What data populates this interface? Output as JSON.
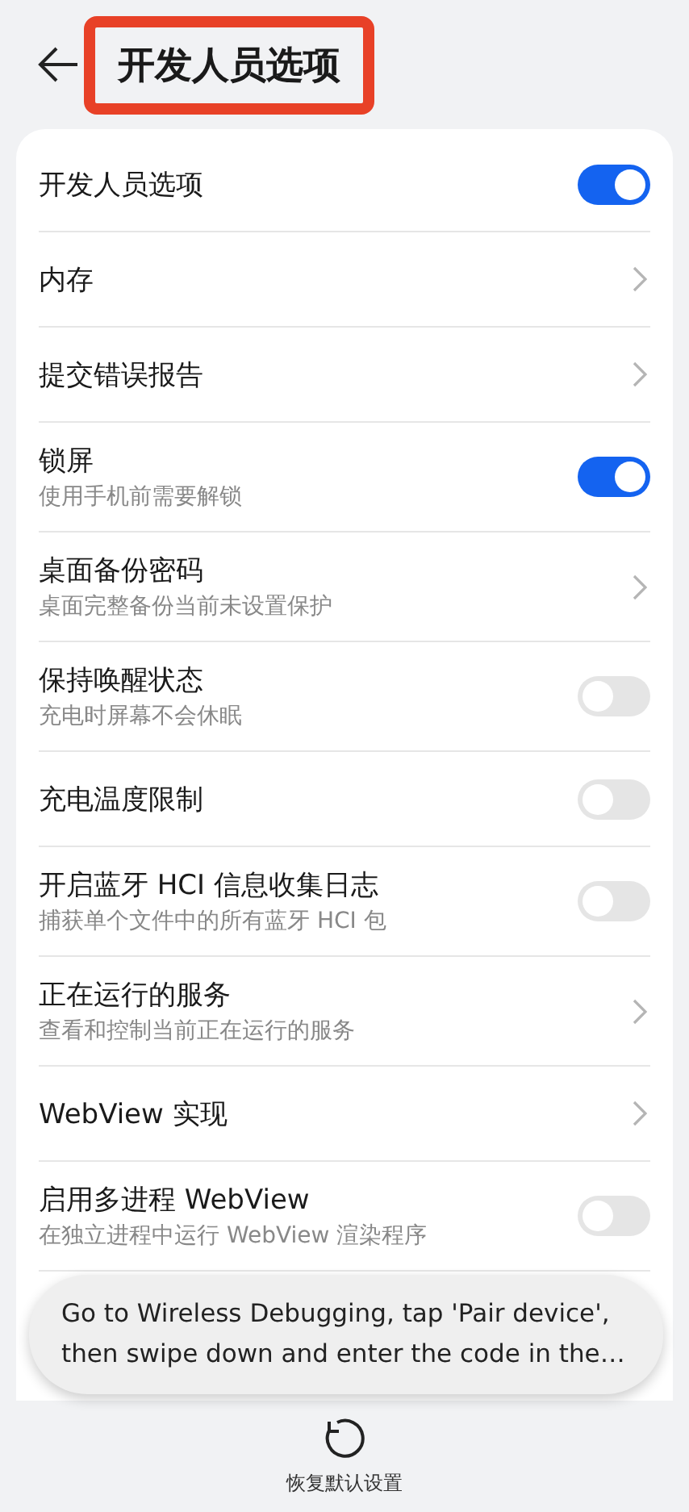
{
  "header": {
    "title": "开发人员选项",
    "highlighted": true
  },
  "settings": [
    {
      "kind": "toggle",
      "title": "开发人员选项",
      "on": true
    },
    {
      "kind": "link",
      "title": "内存"
    },
    {
      "kind": "link",
      "title": "提交错误报告"
    },
    {
      "kind": "toggle",
      "title": "锁屏",
      "subtitle": "使用手机前需要解锁",
      "on": true
    },
    {
      "kind": "link",
      "title": "桌面备份密码",
      "subtitle": "桌面完整备份当前未设置保护"
    },
    {
      "kind": "toggle",
      "title": "保持唤醒状态",
      "subtitle": "充电时屏幕不会休眠",
      "on": false
    },
    {
      "kind": "toggle",
      "title": "充电温度限制",
      "on": false
    },
    {
      "kind": "toggle",
      "title": "开启蓝牙 HCI 信息收集日志",
      "subtitle": "捕获单个文件中的所有蓝牙 HCI 包",
      "on": false
    },
    {
      "kind": "link",
      "title": "正在运行的服务",
      "subtitle": "查看和控制当前正在运行的服务"
    },
    {
      "kind": "link",
      "title": "WebView 实现"
    },
    {
      "kind": "toggle",
      "title": "启用多进程 WebView",
      "subtitle": "在独立进程中运行 WebView 渲染程序",
      "on": false
    }
  ],
  "toast": "Go to Wireless Debugging, tap 'Pair device', then swipe down and enter the code in the…",
  "bottom_action": {
    "label": "恢复默认设置"
  }
}
